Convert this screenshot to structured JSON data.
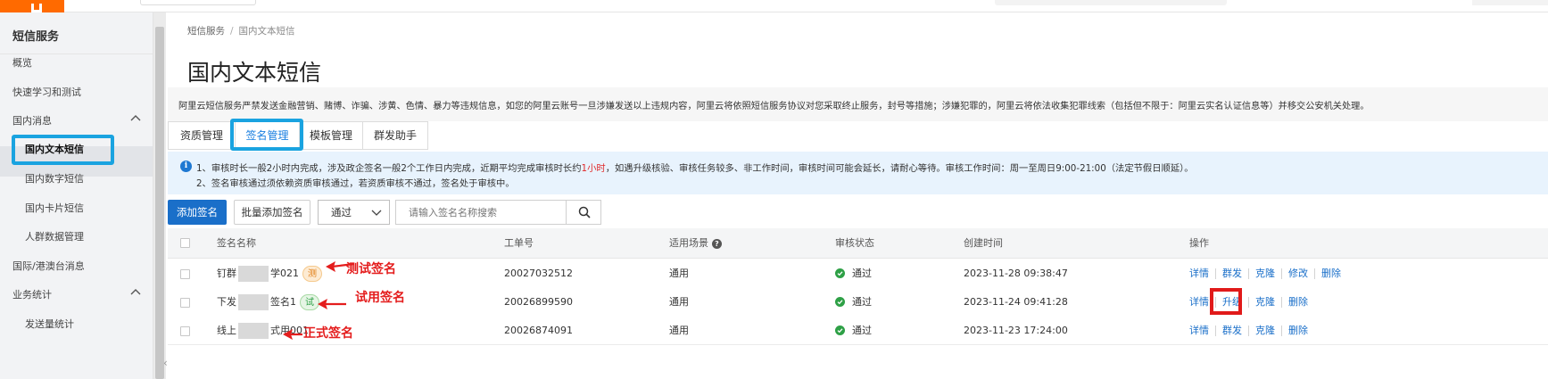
{
  "sidebar": {
    "title": "短信服务",
    "items": [
      {
        "label": "概览"
      },
      {
        "label": "快速学习和测试"
      },
      {
        "label": "国内消息"
      },
      {
        "label": "国内文本短信"
      },
      {
        "label": "国内数字短信"
      },
      {
        "label": "国内卡片短信"
      },
      {
        "label": "人群数据管理"
      },
      {
        "label": "国际/港澳台消息"
      },
      {
        "label": "业务统计"
      },
      {
        "label": "发送量统计"
      }
    ]
  },
  "breadcrumb": {
    "root": "短信服务",
    "sep": "/",
    "current": "国内文本短信"
  },
  "page": {
    "title": "国内文本短信",
    "notice": "阿里云短信服务严禁发送金融营销、赌博、诈骗、涉黄、色情、暴力等违规信息，如您的阿里云账号一旦涉嫌发送以上违规内容，阿里云将依照短信服务协议对您采取终止服务，封号等措施；涉嫌犯罪的，阿里云将依法收集犯罪线索（包括但不限于：阿里云实名认证信息等）并移交公安机关处理。"
  },
  "tabs": [
    "资质管理",
    "签名管理",
    "模板管理",
    "群发助手"
  ],
  "info": {
    "line1_a": "1、审核时长一般2小时内完成，涉及政企签名一般2个工作日内完成，近期平均完成审核时长约",
    "line1_red": "1小时",
    "line1_b": "，如遇升级核验、审核任务较多、非工作时间，审核时间可能会延长，请耐心等待。审核工作时间：周一至周日9:00-21:00（法定节假日顺延）。",
    "line2": "2、签名审核通过须依赖资质审核通过，若资质审核不通过，签名处于审核中。"
  },
  "toolbar": {
    "add_label": "添加签名",
    "batch_label": "批量添加签名",
    "filter_value": "通过",
    "search_placeholder": "请输入签名名称搜索"
  },
  "table": {
    "headers": {
      "name": "签名名称",
      "ticket": "工单号",
      "scene": "适用场景",
      "scene_help": "?",
      "status": "审核状态",
      "created": "创建时间",
      "actions": "操作"
    },
    "rows": [
      {
        "name_pre": "钉群",
        "name_post": "学021",
        "badge": "测",
        "ticket": "20027032512",
        "scene": "通用",
        "status": "通过",
        "created": "2023-11-28 09:38:47",
        "actions": [
          "详情",
          "群发",
          "克隆",
          "修改",
          "删除"
        ]
      },
      {
        "name_pre": "下发",
        "name_post": "签名1",
        "badge": "试",
        "ticket": "20026899590",
        "scene": "通用",
        "status": "通过",
        "created": "2023-11-24 09:41:28",
        "actions": [
          "详情",
          "升级",
          "克隆",
          "删除"
        ]
      },
      {
        "name_pre": "线上",
        "name_post": "式用001",
        "badge": "",
        "ticket": "20026874091",
        "scene": "通用",
        "status": "通过",
        "created": "2023-11-23 17:24:00",
        "actions": [
          "详情",
          "群发",
          "克隆",
          "删除"
        ]
      }
    ]
  },
  "annotations": {
    "test_sign": "测试签名",
    "trial_sign": "试用签名",
    "formal_sign": "正式签名"
  },
  "colors": {
    "accent": "#1a6fc9",
    "highlight_blue": "#1aa3e0",
    "highlight_red": "#e11a1a",
    "success": "#2ea046",
    "brand_orange": "#ff6a00"
  }
}
